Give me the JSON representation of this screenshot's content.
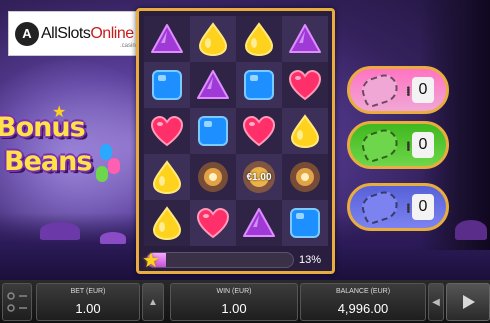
{
  "logo": {
    "badge": "A",
    "text_main": "AllSlots",
    "text_accent": "Online",
    "sub": ".casino"
  },
  "game_title": {
    "line1": "Bonus",
    "line2": "Beans"
  },
  "board": {
    "grid": [
      [
        "triangle-purple",
        "drop-yellow",
        "drop-yellow",
        "triangle-purple"
      ],
      [
        "square-blue",
        "triangle-purple",
        "square-blue",
        "heart-red"
      ],
      [
        "heart-red",
        "square-blue",
        "heart-red",
        "drop-yellow"
      ],
      [
        "drop-yellow",
        "burst-orange",
        "coin-burst",
        "burst-orange"
      ],
      [
        "drop-yellow",
        "heart-red",
        "triangle-purple",
        "square-blue"
      ]
    ],
    "coin_value": "€1.00",
    "progress_pct_value": 0.13,
    "progress_label": "13%"
  },
  "collectors": [
    {
      "name": "pink",
      "color": "#f0a7d6",
      "border_bg": "#ff74c2",
      "count": "0"
    },
    {
      "name": "green",
      "color": "#6ed64a",
      "border_bg": "#3fb81e",
      "count": "0"
    },
    {
      "name": "blue",
      "color": "#7c83f0",
      "border_bg": "#5761d8",
      "count": "0"
    }
  ],
  "bottom": {
    "bet_label": "BET (EUR)",
    "bet_value": "1.00",
    "win_label": "WIN (EUR)",
    "win_value": "1.00",
    "balance_label": "BALANCE (EUR)",
    "balance_value": "4,996.00"
  },
  "colors": {
    "gold_border": "#e9ac3e",
    "accent_red": "#c81e1e"
  }
}
